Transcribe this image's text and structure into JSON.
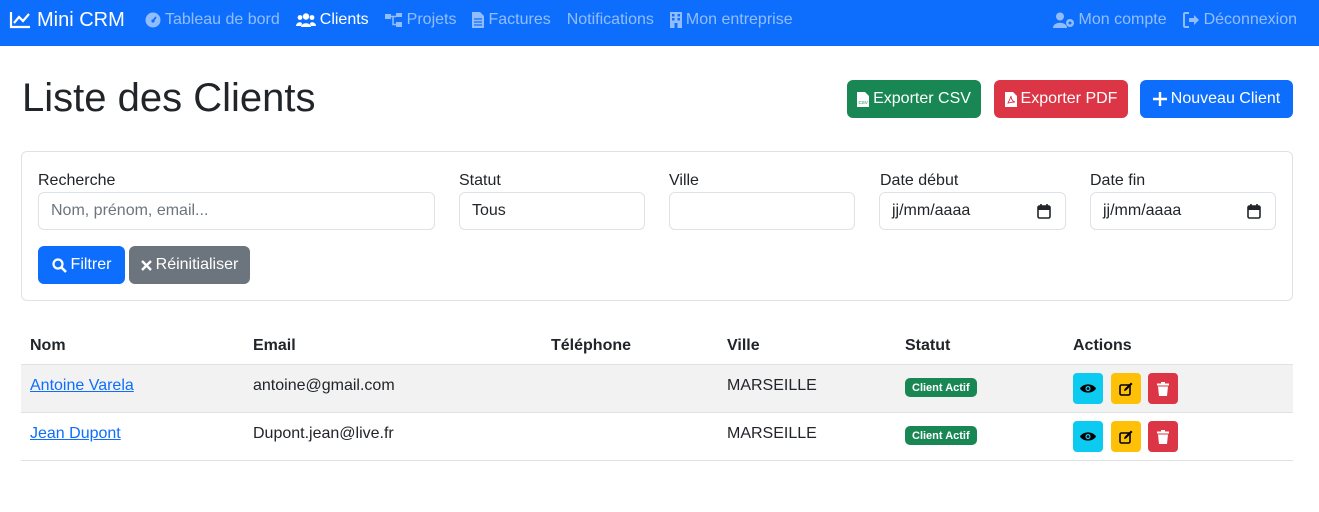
{
  "navbar": {
    "brand": "Mini CRM",
    "items": [
      {
        "label": "Tableau de bord",
        "icon": "gauge-icon",
        "active": false
      },
      {
        "label": "Clients",
        "icon": "users-icon",
        "active": true
      },
      {
        "label": "Projets",
        "icon": "sitemap-icon",
        "active": false
      },
      {
        "label": "Factures",
        "icon": "file-invoice-icon",
        "active": false
      },
      {
        "label": "Notifications",
        "icon": "",
        "active": false
      },
      {
        "label": "Mon entreprise",
        "icon": "building-icon",
        "active": false
      }
    ],
    "right": [
      {
        "label": "Mon compte",
        "icon": "user-cog-icon"
      },
      {
        "label": "Déconnexion",
        "icon": "sign-out-icon"
      }
    ]
  },
  "page": {
    "title": "Liste des Clients",
    "export_csv": "Exporter CSV",
    "export_pdf": "Exporter PDF",
    "new_client": "Nouveau Client"
  },
  "filters": {
    "search_label": "Recherche",
    "search_placeholder": "Nom, prénom, email...",
    "status_label": "Statut",
    "status_value": "Tous",
    "city_label": "Ville",
    "city_value": "",
    "date_start_label": "Date début",
    "date_start_value": "jj/mm/aaaa",
    "date_end_label": "Date fin",
    "date_end_value": "jj/mm/aaaa",
    "filter_button": "Filtrer",
    "reset_button": "Réinitialiser"
  },
  "table": {
    "headers": [
      "Nom",
      "Email",
      "Téléphone",
      "Ville",
      "Statut",
      "Actions"
    ],
    "rows": [
      {
        "name": "Antoine Varela",
        "email": "antoine@gmail.com",
        "phone": "",
        "city": "MARSEILLE",
        "status": "Client Actif"
      },
      {
        "name": "Jean Dupont",
        "email": "Dupont.jean@live.fr",
        "phone": "",
        "city": "MARSEILLE",
        "status": "Client Actif"
      }
    ]
  },
  "colors": {
    "primary": "#0d6efd",
    "success": "#198754",
    "danger": "#dc3545",
    "secondary": "#6c757d",
    "info": "#0dcaf0",
    "warning": "#ffc107"
  }
}
